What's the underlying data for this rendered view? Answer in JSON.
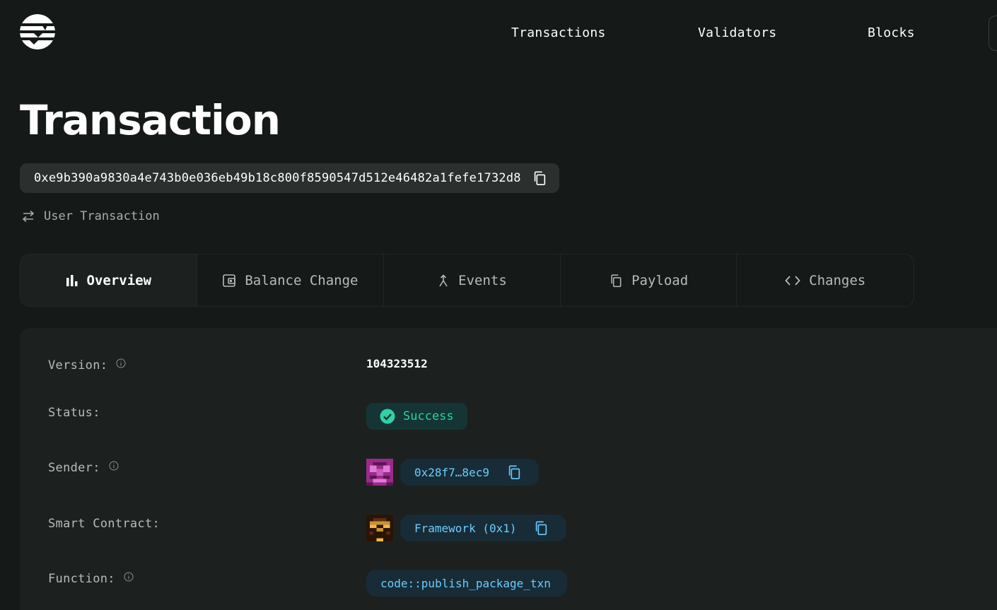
{
  "header": {
    "nav": [
      "Transactions",
      "Validators",
      "Blocks"
    ]
  },
  "page": {
    "title": "Transaction",
    "hash": "0xe9b390a9830a4e743b0e036eb49b18c800f8590547d512e46482a1fefe1732d8",
    "type": "User Transaction"
  },
  "tabs": [
    {
      "label": "Overview",
      "icon": "bar-chart-icon",
      "active": true
    },
    {
      "label": "Balance Change",
      "icon": "wallet-icon",
      "active": false
    },
    {
      "label": "Events",
      "icon": "merge-arrow-icon",
      "active": false
    },
    {
      "label": "Payload",
      "icon": "copy-icon",
      "active": false
    },
    {
      "label": "Changes",
      "icon": "code-brackets-icon",
      "active": false
    }
  ],
  "overview": {
    "version_label": "Version:",
    "version_value": "104323512",
    "status_label": "Status:",
    "status_value": "Success",
    "sender_label": "Sender:",
    "sender_value": "0x28f7…8ec9",
    "contract_label": "Smart Contract:",
    "contract_value": "Framework (0x1)",
    "function_label": "Function:",
    "function_value": "code::publish_package_txn"
  },
  "colors": {
    "background": "#151918",
    "card": "#1c2120",
    "success": "#2fd1a5",
    "link": "#6ecbff"
  }
}
